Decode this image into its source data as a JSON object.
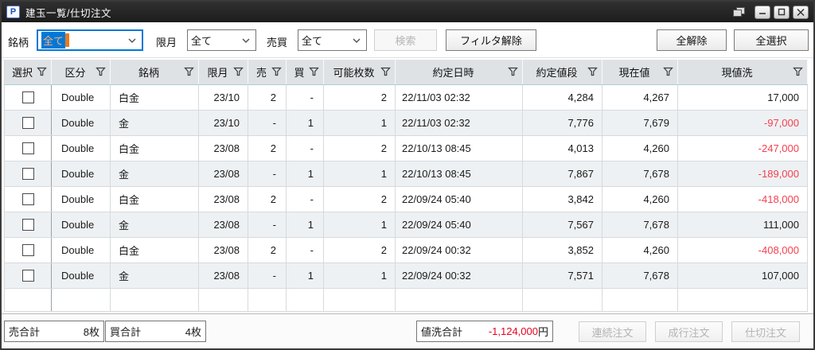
{
  "colors": {
    "accent": "#0078d7",
    "negative_cell": "#f4404f",
    "negative_total": "#e8001f",
    "header_bg": "#dfe2e5",
    "row_alt_bg": "#eef1f3",
    "titlebar_bg": "#1c1c1c"
  },
  "window": {
    "title": "建玉一覧/仕切注文",
    "icon_glyph": "P"
  },
  "toolbar": {
    "symbol_label": "銘柄",
    "symbol_value": "全て",
    "month_label": "限月",
    "month_value": "全て",
    "side_label": "売買",
    "side_value": "全て",
    "search_label": "検索",
    "clear_filter_label": "フィルタ解除",
    "deselect_all_label": "全解除",
    "select_all_label": "全選択"
  },
  "table": {
    "headers": [
      "選択",
      "区分",
      "銘柄",
      "限月",
      "売",
      "買",
      "可能枚数",
      "約定日時",
      "約定値段",
      "現在値",
      "現値洗"
    ],
    "rows": [
      {
        "selected": false,
        "category": "Double",
        "symbol": "白金",
        "month": "23/10",
        "sell": "2",
        "buy": "-",
        "qty": "2",
        "datetime": "22/11/03 02:32",
        "price": "4,284",
        "current": "4,267",
        "pl": "17,000"
      },
      {
        "selected": false,
        "category": "Double",
        "symbol": "金",
        "month": "23/10",
        "sell": "-",
        "buy": "1",
        "qty": "1",
        "datetime": "22/11/03 02:32",
        "price": "7,776",
        "current": "7,679",
        "pl": "-97,000"
      },
      {
        "selected": false,
        "category": "Double",
        "symbol": "白金",
        "month": "23/08",
        "sell": "2",
        "buy": "-",
        "qty": "2",
        "datetime": "22/10/13 08:45",
        "price": "4,013",
        "current": "4,260",
        "pl": "-247,000"
      },
      {
        "selected": false,
        "category": "Double",
        "symbol": "金",
        "month": "23/08",
        "sell": "-",
        "buy": "1",
        "qty": "1",
        "datetime": "22/10/13 08:45",
        "price": "7,867",
        "current": "7,678",
        "pl": "-189,000"
      },
      {
        "selected": false,
        "category": "Double",
        "symbol": "白金",
        "month": "23/08",
        "sell": "2",
        "buy": "-",
        "qty": "2",
        "datetime": "22/09/24 05:40",
        "price": "3,842",
        "current": "4,260",
        "pl": "-418,000"
      },
      {
        "selected": false,
        "category": "Double",
        "symbol": "金",
        "month": "23/08",
        "sell": "-",
        "buy": "1",
        "qty": "1",
        "datetime": "22/09/24 05:40",
        "price": "7,567",
        "current": "7,678",
        "pl": "111,000"
      },
      {
        "selected": false,
        "category": "Double",
        "symbol": "白金",
        "month": "23/08",
        "sell": "2",
        "buy": "-",
        "qty": "2",
        "datetime": "22/09/24 00:32",
        "price": "3,852",
        "current": "4,260",
        "pl": "-408,000"
      },
      {
        "selected": false,
        "category": "Double",
        "symbol": "金",
        "month": "23/08",
        "sell": "-",
        "buy": "1",
        "qty": "1",
        "datetime": "22/09/24 00:32",
        "price": "7,571",
        "current": "7,678",
        "pl": "107,000"
      }
    ]
  },
  "footer": {
    "sell_total_label": "売合計",
    "sell_total_value": "8枚",
    "buy_total_label": "買合計",
    "buy_total_value": "4枚",
    "pl_total_label": "値洗合計",
    "pl_total_value": "-1,124,000",
    "pl_total_unit": "円",
    "continuous_order_label": "連続注文",
    "market_order_label": "成行注文",
    "close_order_label": "仕切注文"
  }
}
